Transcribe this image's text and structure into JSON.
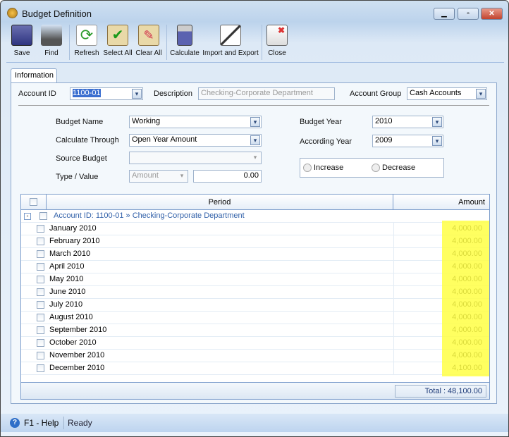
{
  "window": {
    "title": "Budget Definition"
  },
  "toolbar": [
    {
      "label": "Save",
      "icon": "floppy-disk-icon"
    },
    {
      "label": "Find",
      "icon": "binoculars-icon"
    },
    {
      "label": "Refresh",
      "icon": "refresh-icon"
    },
    {
      "label": "Select All",
      "icon": "clipboard-check-icon"
    },
    {
      "label": "Clear All",
      "icon": "clipboard-eraser-icon"
    },
    {
      "label": "Calculate",
      "icon": "calculator-icon"
    },
    {
      "label": "Import and Export",
      "icon": "wand-icon"
    },
    {
      "label": "Close",
      "icon": "close-window-icon"
    }
  ],
  "tabs": [
    {
      "label": "Information"
    }
  ],
  "header": {
    "account_id_label": "Account ID",
    "account_id": "1100-01",
    "description_label": "Description",
    "description": "Checking-Corporate Department",
    "account_group_label": "Account Group",
    "account_group": "Cash Accounts"
  },
  "form": {
    "budget_name_label": "Budget Name",
    "budget_name": "Working",
    "calc_through_label": "Calculate Through",
    "calc_through": "Open Year Amount",
    "source_budget_label": "Source Budget",
    "source_budget": "",
    "type_value_label": "Type / Value",
    "type": "Amount",
    "value": "0.00",
    "budget_year_label": "Budget Year",
    "budget_year": "2010",
    "according_year_label": "According Year",
    "according_year": "2009",
    "increase_label": "Increase",
    "decrease_label": "Decrease"
  },
  "grid": {
    "columns": [
      "Period",
      "Amount"
    ],
    "group": "Account ID: 1100-01 » Checking-Corporate Department",
    "rows": [
      {
        "period": "January 2010",
        "amount": "4,000.00"
      },
      {
        "period": "February 2010",
        "amount": "4,000.00"
      },
      {
        "period": "March 2010",
        "amount": "4,000.00"
      },
      {
        "period": "April 2010",
        "amount": "4,000.00"
      },
      {
        "period": "May 2010",
        "amount": "4,000.00"
      },
      {
        "period": "June 2010",
        "amount": "4,000.00"
      },
      {
        "period": "July 2010",
        "amount": "4,000.00"
      },
      {
        "period": "August 2010",
        "amount": "4,000.00"
      },
      {
        "period": "September 2010",
        "amount": "4,000.00"
      },
      {
        "period": "October 2010",
        "amount": "4,000.00"
      },
      {
        "period": "November 2010",
        "amount": "4,000.00"
      },
      {
        "period": "December 2010",
        "amount": "4,100.00"
      }
    ],
    "total": "Total : 48,100.00",
    "highlight_color": "#ffff44"
  },
  "status": {
    "help": "F1 - Help",
    "state": "Ready"
  }
}
